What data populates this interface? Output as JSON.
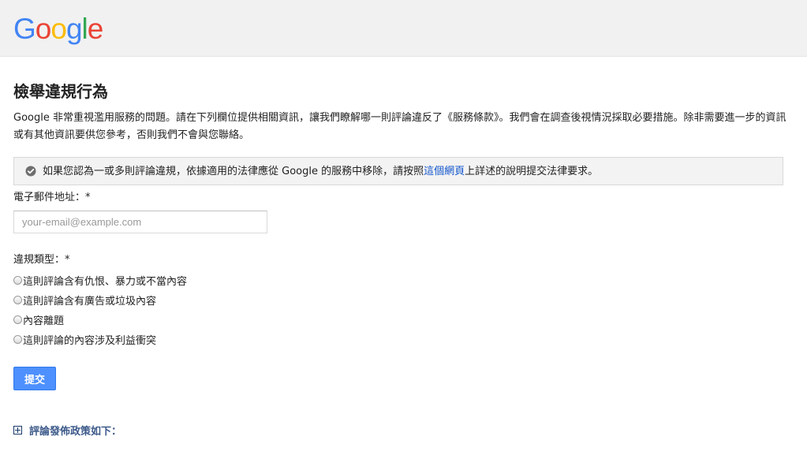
{
  "header": {
    "logo_letters": [
      "G",
      "o",
      "o",
      "g",
      "l",
      "e"
    ],
    "logo_colors": [
      "#4285F4",
      "#EA4335",
      "#FBBC05",
      "#4285F4",
      "#34A853",
      "#EA4335"
    ]
  },
  "page": {
    "title": "檢舉違規行為",
    "intro": "Google 非常重視濫用服務的問題。請在下列欄位提供相關資訊，讓我們瞭解哪一則評論違反了《服務條款》。我們會在調查後視情況採取必要措施。除非需要進一步的資訊或有其他資訊要供您參考，否則我們不會與您聯絡。"
  },
  "notice": {
    "icon": "check-circle-icon",
    "text_before": "如果您認為一或多則評論違規，依據適用的法律應從 Google 的服務中移除，請按照",
    "link": "這個網頁",
    "text_after": "上詳述的說明提交法律要求。"
  },
  "form": {
    "email_label": "電子郵件地址：*",
    "email_placeholder": "your-email@example.com",
    "email_value": "",
    "type_label": "違規類型：*",
    "options": [
      "這則評論含有仇恨、暴力或不當內容",
      "這則評論含有廣告或垃圾內容",
      "內容離題",
      "這則評論的內容涉及利益衝突"
    ],
    "submit_label": "提交"
  },
  "policy": {
    "icon": "plus-box-icon",
    "label": "評論發佈政策如下："
  }
}
